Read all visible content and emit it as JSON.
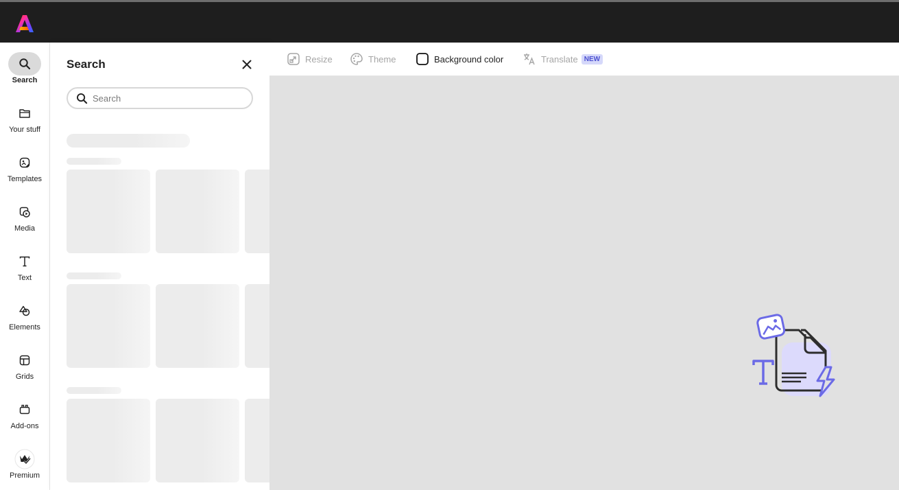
{
  "rail": {
    "items": [
      {
        "label": "Search",
        "icon": "search-icon"
      },
      {
        "label": "Your stuff",
        "icon": "folder-icon"
      },
      {
        "label": "Templates",
        "icon": "templates-icon"
      },
      {
        "label": "Media",
        "icon": "media-icon"
      },
      {
        "label": "Text",
        "icon": "text-icon"
      },
      {
        "label": "Elements",
        "icon": "elements-icon"
      },
      {
        "label": "Grids",
        "icon": "grids-icon"
      },
      {
        "label": "Add-ons",
        "icon": "add-ons-icon"
      },
      {
        "label": "Premium",
        "icon": "premium-icon"
      }
    ]
  },
  "panel": {
    "title": "Search",
    "search": {
      "placeholder": "Search",
      "value": ""
    }
  },
  "toolbar": {
    "resize": "Resize",
    "theme": "Theme",
    "background_color": "Background color",
    "translate": "Translate",
    "translate_badge": "NEW"
  },
  "colors": {
    "topbar": "#1e1e1e",
    "canvas": "#e1e1e1",
    "accent": "#6b6ae6",
    "badge_bg": "#d5d8fa"
  }
}
